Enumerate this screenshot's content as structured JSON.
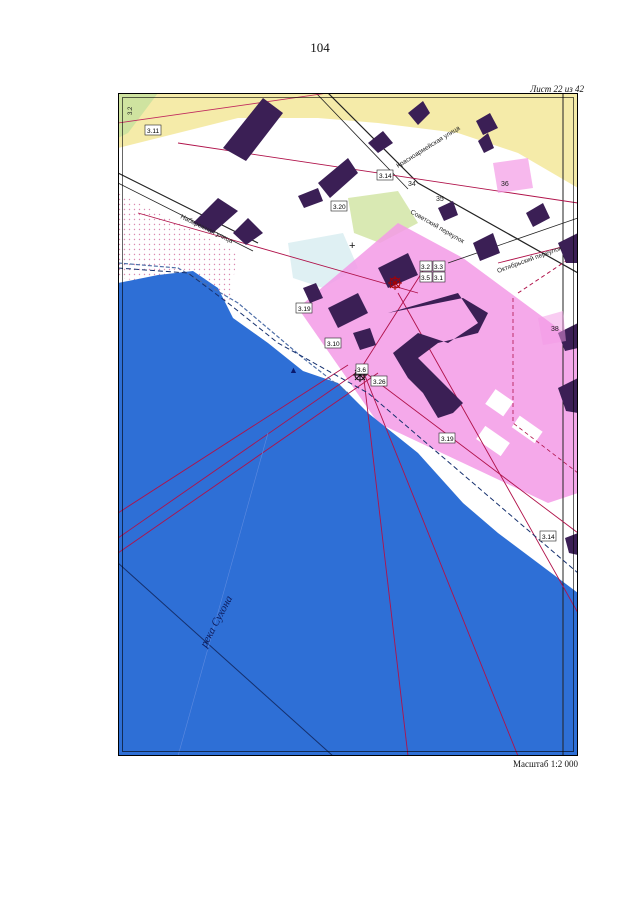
{
  "page_number": "104",
  "sheet": "Лист 22 из 42",
  "scale": "Масштаб 1:2 000",
  "streets": {
    "naberezhnaya": "Набережная улица",
    "krasnoarmeyskaya": "Красноармейская улица",
    "sovetsky": "Советский переулок",
    "oktyabrsky": "Октябрьский переулок"
  },
  "river": "река Сухона",
  "lot_numbers": [
    "34",
    "36",
    "35",
    "38"
  ],
  "zone_labels": [
    "3.11",
    "3.14",
    "3.20",
    "3.19",
    "3.10",
    "3.26",
    "3.19",
    "3.14",
    "3.2",
    "3.3",
    "3.5",
    "3.1",
    "3.6"
  ],
  "colors": {
    "water": "#2e6fd6",
    "protection_zone": "#f39ae6",
    "building": "#3b1f55",
    "boundary": "#b0124a",
    "meadow": "#f3e79a",
    "green": "#cfe3a0"
  }
}
